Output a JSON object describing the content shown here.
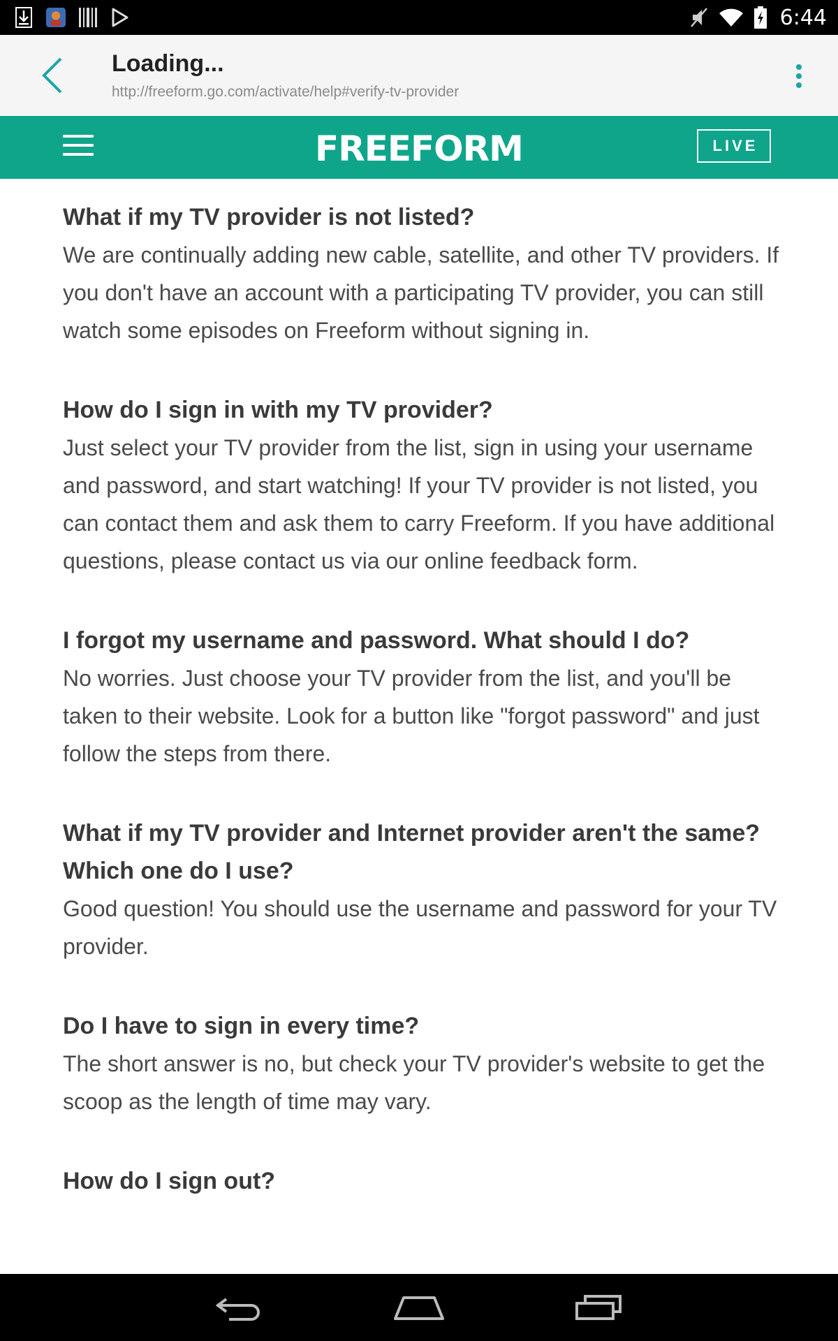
{
  "statusbar": {
    "time": "6:44",
    "icons": [
      "download-icon",
      "app-avatar-icon",
      "barcode-icon",
      "play-store-icon",
      "mute-icon",
      "wifi-icon",
      "battery-charging-icon"
    ]
  },
  "toolbar": {
    "title": "Loading...",
    "url": "http://freeform.go.com/activate/help#verify-tv-provider"
  },
  "header": {
    "logo": "FREEFORM",
    "live_label": "LIVE",
    "brand_color": "#0ea58a"
  },
  "faqs": [
    {
      "question": "What if my TV provider is not listed?",
      "answer": "We are continually adding new cable, satellite, and other TV providers. If you don't have an account with a participating TV provider, you can still watch some episodes on Freeform without signing in."
    },
    {
      "question": "How do I sign in with my TV provider?",
      "answer": "Just select your TV provider from the list, sign in using your username and password, and start watching! If your TV provider is not listed, you can contact them and ask them to carry Freeform. If you have additional questions, please contact us via our online feedback form."
    },
    {
      "question": "I forgot my username and password. What should I do?",
      "answer": "No worries. Just choose your TV provider from the list, and you'll be taken to their website. Look for a button like \"forgot password\" and just follow the steps from there."
    },
    {
      "question": "What if my TV provider and Internet provider aren't the same? Which one do I use?",
      "answer": "Good question! You should use the username and password for your TV provider."
    },
    {
      "question": "Do I have to sign in every time?",
      "answer": "The short answer is no, but check your TV provider's website to get the scoop as the length of time may vary."
    },
    {
      "question": "How do I sign out?",
      "answer": ""
    }
  ],
  "navbar": {
    "buttons": [
      "back-nav-icon",
      "home-nav-icon",
      "recents-nav-icon"
    ]
  }
}
